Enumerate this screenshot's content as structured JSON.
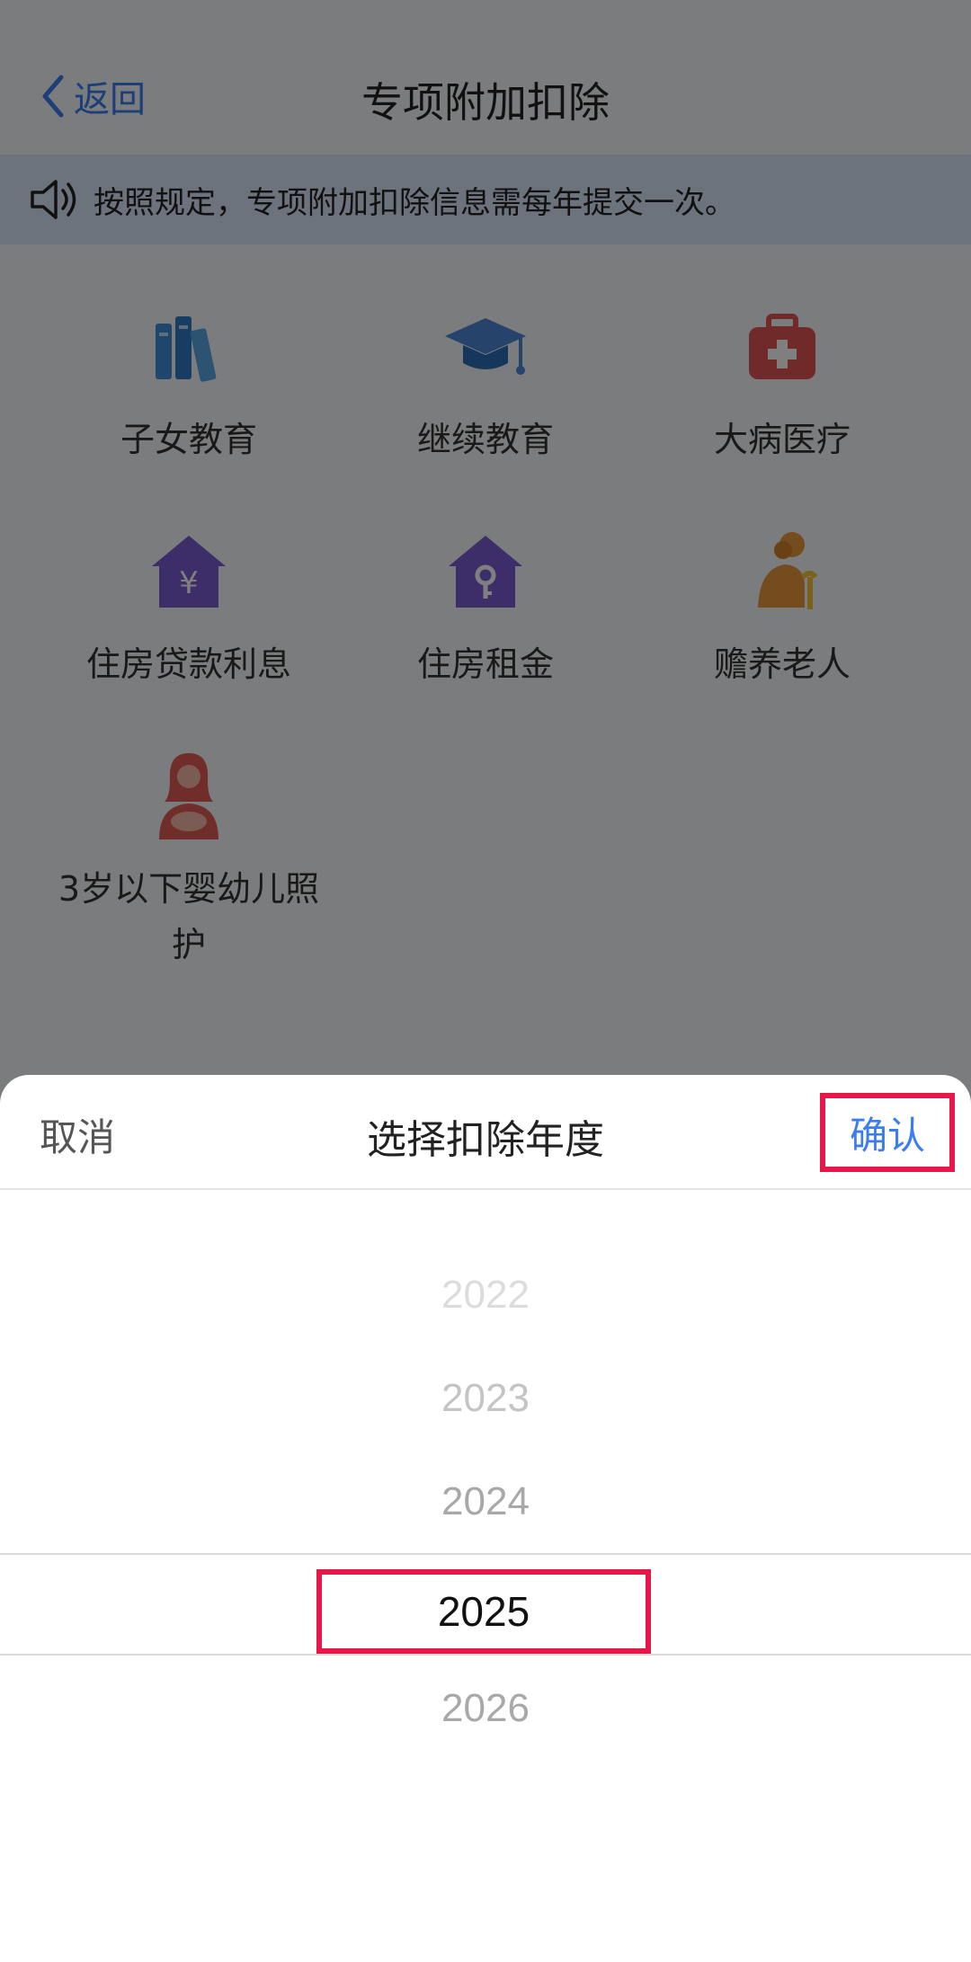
{
  "navbar": {
    "back_label": "返回",
    "title": "专项附加扣除"
  },
  "notice": {
    "text": "按照规定，专项附加扣除信息需每年提交一次。"
  },
  "categories": [
    {
      "label": "子女教育",
      "icon": "books-icon",
      "color": "#3d8fd6"
    },
    {
      "label": "继续教育",
      "icon": "graduation-cap-icon",
      "color": "#4a87d6"
    },
    {
      "label": "大病医疗",
      "icon": "medical-kit-icon",
      "color": "#e05552"
    },
    {
      "label": "住房贷款利息",
      "icon": "house-yen-icon",
      "color": "#7a5bd3"
    },
    {
      "label": "住房租金",
      "icon": "house-key-icon",
      "color": "#7a5bd3"
    },
    {
      "label": "赡养老人",
      "icon": "elderly-icon",
      "color": "#e8983a"
    },
    {
      "label": "3岁以下婴幼儿照护",
      "icon": "mother-baby-icon",
      "color": "#e05a52"
    }
  ],
  "sheet": {
    "cancel_label": "取消",
    "title": "选择扣除年度",
    "confirm_label": "确认",
    "years": [
      "2022",
      "2023",
      "2024",
      "2025",
      "2026"
    ],
    "selected_year": "2025"
  },
  "colors": {
    "accent": "#3b7cf0",
    "highlight": "#e8174a"
  }
}
